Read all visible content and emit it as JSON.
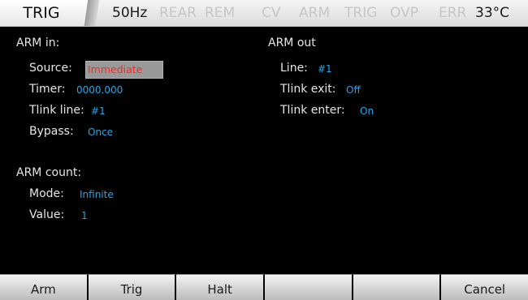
{
  "status_bar": {
    "menu": "TRIG",
    "frequency": "50Hz",
    "indicators": [
      "REAR",
      "REM",
      "CV",
      "ARM",
      "TRIG",
      "OVP",
      "ERR"
    ],
    "temperature": "33°C"
  },
  "arm_in": {
    "title": "ARM in:",
    "source_label": "Source:",
    "source_value": "Immediate",
    "timer_label": "Timer:",
    "timer_value": "0000.000",
    "tlink_line_label": "Tlink line:",
    "tlink_line_value": "#1",
    "bypass_label": "Bypass:",
    "bypass_value": "Once"
  },
  "arm_out": {
    "title": "ARM out",
    "line_label": "Line:",
    "line_value": "#1",
    "tlink_exit_label": "Tlink exit:",
    "tlink_exit_value": "Off",
    "tlink_enter_label": "Tlink enter:",
    "tlink_enter_value": "On"
  },
  "arm_count": {
    "title": "ARM count:",
    "mode_label": "Mode:",
    "mode_value": "Infinite",
    "value_label": "Value:",
    "value_value": "1"
  },
  "softkeys": [
    "Arm",
    "Trig",
    "Halt",
    "",
    "",
    "Cancel"
  ],
  "colors": {
    "value_text": "#24a6e8",
    "selected_text": "#ff2a1f",
    "selected_bg": "#999999",
    "background": "#000000"
  }
}
